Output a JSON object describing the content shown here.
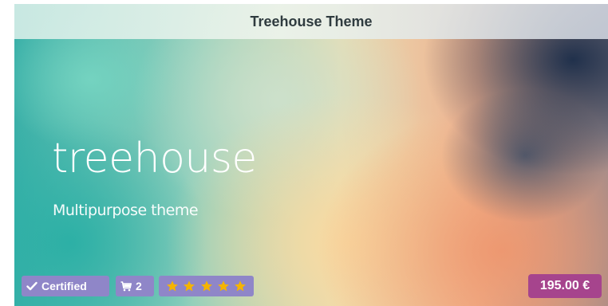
{
  "card": {
    "title": "Treehouse Theme",
    "hero_title": "treehouse",
    "hero_subtitle": "Multipurpose theme",
    "certified_label": "Certified",
    "cart_count": "2",
    "rating_stars": 5,
    "price": "195.00 €"
  },
  "icons": {
    "certified": "check-icon",
    "cart": "shopping-cart-icon",
    "rating": "star-icon"
  },
  "colors": {
    "badge_background": "#8f86c8",
    "price_background": "#a6448d",
    "star_color": "#f5b400",
    "title_text": "#2f3b3f"
  }
}
